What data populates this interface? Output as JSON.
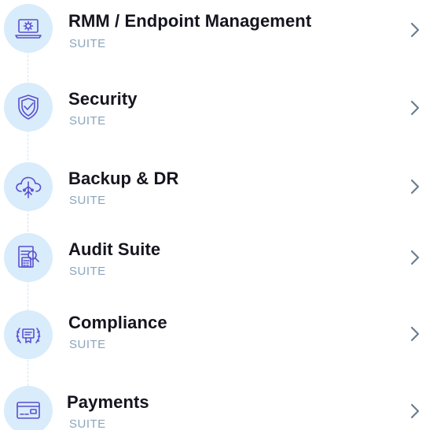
{
  "accent_color": "#5b4fcf",
  "icon_bg_color": "#d8ecfb",
  "subtitle_color": "#8aa4bb",
  "items": [
    {
      "title": "RMM / Endpoint Management",
      "subtitle": "SUITE",
      "icon": "laptop-gear-icon"
    },
    {
      "title": "Security",
      "subtitle": "SUITE",
      "icon": "shield-check-icon"
    },
    {
      "title": "Backup & DR",
      "subtitle": "SUITE",
      "icon": "cloud-network-icon"
    },
    {
      "title": "Audit Suite",
      "subtitle": "SUITE",
      "icon": "audit-document-magnifier-icon"
    },
    {
      "title": "Compliance",
      "subtitle": "SUITE",
      "icon": "laurel-certificate-icon"
    },
    {
      "title": "Payments",
      "subtitle": "SUITE",
      "icon": "credit-card-icon"
    }
  ]
}
